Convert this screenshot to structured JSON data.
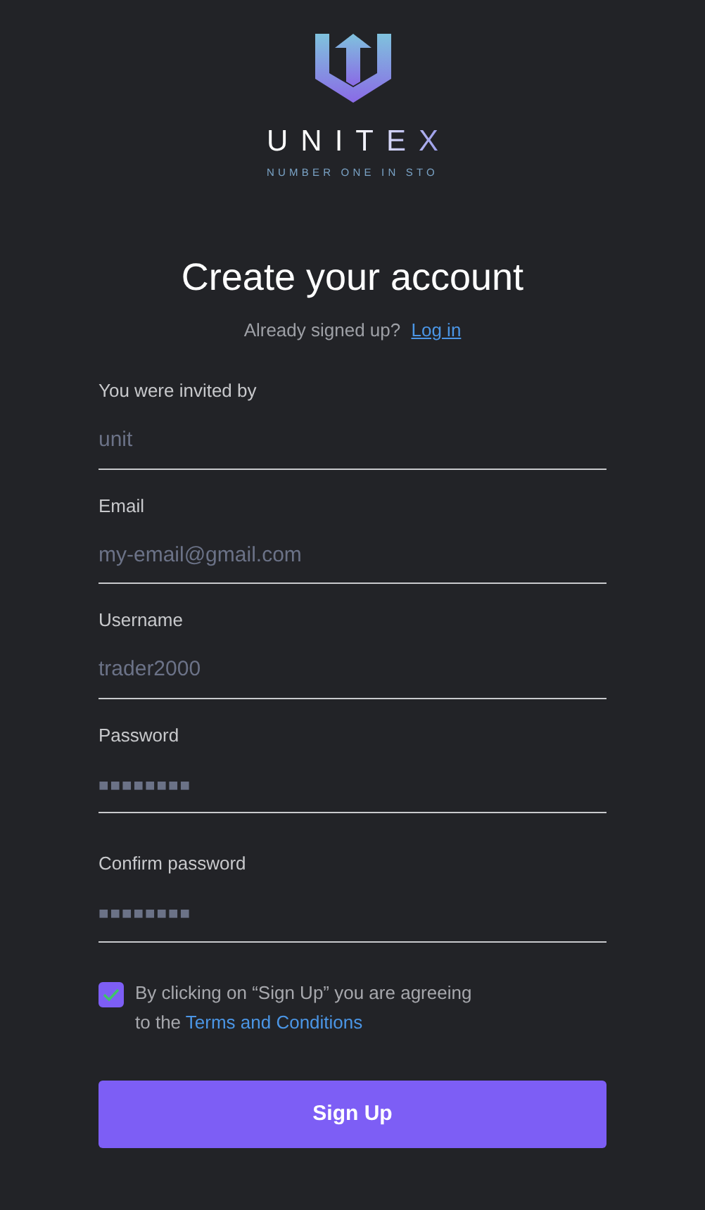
{
  "brand": {
    "name": "UNITEX",
    "tagline": "NUMBER ONE IN STO"
  },
  "heading": "Create your account",
  "signin": {
    "text": "Already signed up?",
    "link": "Log in"
  },
  "fields": [
    {
      "label": "You were invited by",
      "placeholder": "unit",
      "kind": "text"
    },
    {
      "label": "Email",
      "placeholder": "my-email@gmail.com",
      "kind": "text"
    },
    {
      "label": "Username",
      "placeholder": "trader2000",
      "kind": "text"
    },
    {
      "label": "Password",
      "placeholder": "■■■■■■■■",
      "kind": "password"
    },
    {
      "label": "Confirm password",
      "placeholder": "■■■■■■■■",
      "kind": "password"
    }
  ],
  "agreement": {
    "checked": true,
    "text": "By clicking on “Sign Up” you are agreeing to the",
    "link": "Terms and Conditions"
  },
  "submit": "Sign Up"
}
